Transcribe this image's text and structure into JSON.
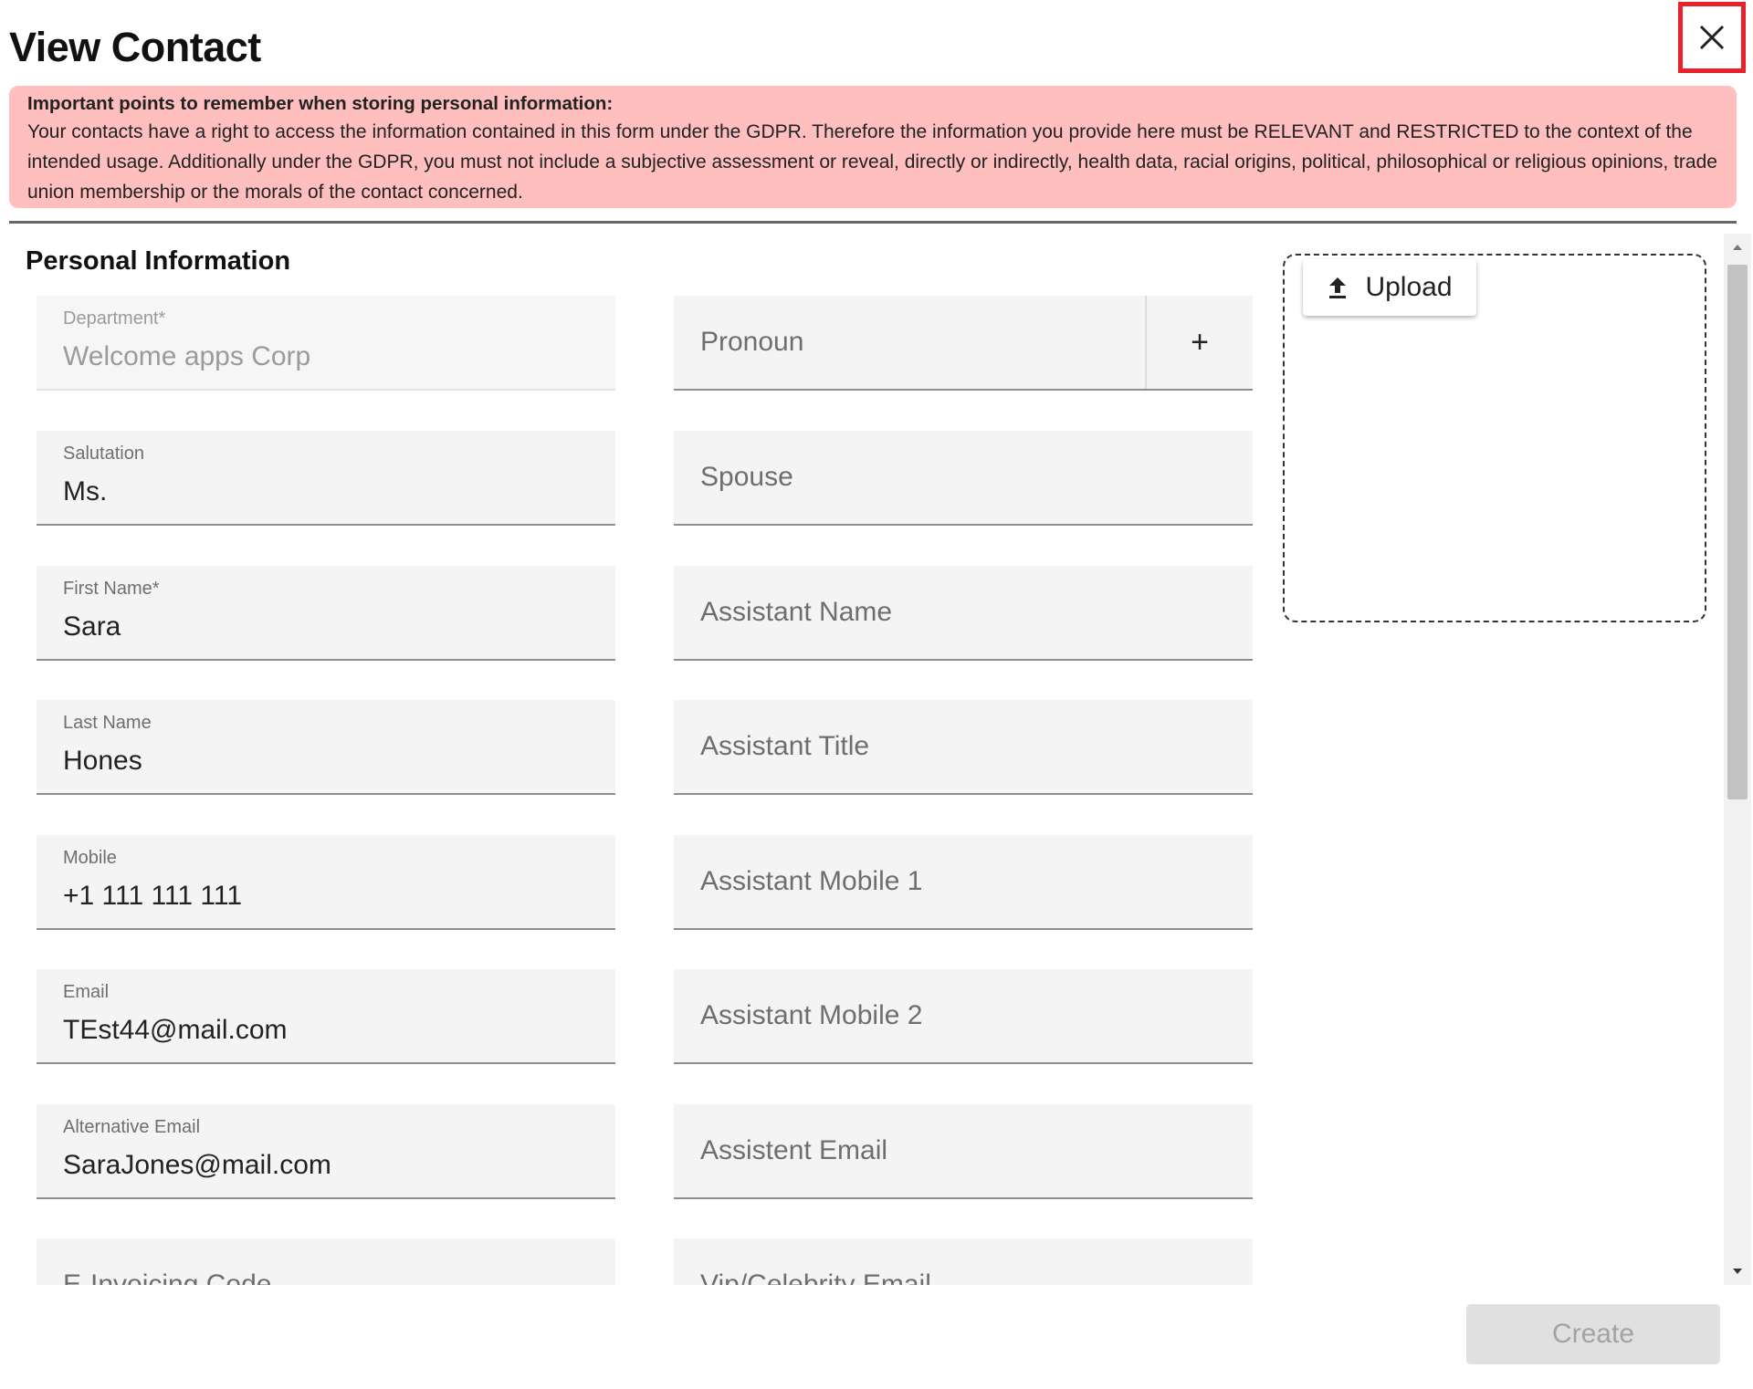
{
  "dialog": {
    "title": "View Contact",
    "close_icon": "close-icon"
  },
  "notice": {
    "title": "Important points to remember when storing personal information:",
    "body": "Your contacts have a right to access the information contained in this form under the GDPR. Therefore the information you provide here must be RELEVANT and RESTRICTED to the context of the intended usage. Additionally under the GDPR, you must not include a subjective assessment or reveal, directly or indirectly, health data, racial origins, political, philosophical or religious opinions, trade union membership or the morals of the contact concerned.",
    "background": "#ffbfbf"
  },
  "section": {
    "title": "Personal Information"
  },
  "left_fields": [
    {
      "label": "Department*",
      "value": "Welcome apps Corp",
      "disabled": true
    },
    {
      "label": "Salutation",
      "value": "Ms."
    },
    {
      "label": "First Name*",
      "value": "Sara"
    },
    {
      "label": "Last Name",
      "value": "Hones"
    },
    {
      "label": "Mobile",
      "value": "+1 111 111 111"
    },
    {
      "label": "Email",
      "value": "TEst44@mail.com"
    },
    {
      "label": "Alternative Email",
      "value": "SaraJones@mail.com"
    },
    {
      "placeholder": "E-Invoicing Code"
    }
  ],
  "right_fields": [
    {
      "placeholder": "Pronoun",
      "add_button": "+"
    },
    {
      "placeholder": "Spouse"
    },
    {
      "placeholder": "Assistant Name"
    },
    {
      "placeholder": "Assistant Title"
    },
    {
      "placeholder": "Assistant Mobile 1"
    },
    {
      "placeholder": "Assistant Mobile 2"
    },
    {
      "placeholder": "Assistent Email"
    },
    {
      "placeholder": "Vip/Celebrity Email"
    }
  ],
  "upload": {
    "label": "Upload",
    "icon": "upload-icon"
  },
  "footer": {
    "create_label": "Create"
  },
  "colors": {
    "close_highlight": "#e8222c",
    "field_background": "#f4f4f4",
    "disabled_button": "#e0e0e0"
  }
}
